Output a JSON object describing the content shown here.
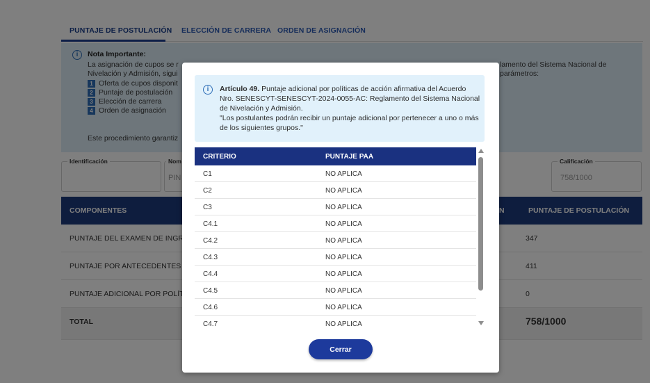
{
  "tabs": [
    "PUNTAJE DE POSTULACIÓN",
    "ELECCIÓN DE CARRERA",
    "ORDEN DE ASIGNACIÓN"
  ],
  "note": {
    "title": "Nota Importante:",
    "line1": "La asignación de cupos se r",
    "line1_right": "lamento del Sistema Nacional de",
    "line2": "Nivelación y Admisión, sigui",
    "line2_right": "parámetros:",
    "items": [
      {
        "num": "1",
        "label": "Oferta de cupos disponit"
      },
      {
        "num": "2",
        "label": "Puntaje de postulación"
      },
      {
        "num": "3",
        "label": "Elección de carrera"
      },
      {
        "num": "4",
        "label": "Orden de asignación"
      }
    ],
    "footer": "Este procedimiento garantiz"
  },
  "fields": {
    "identificacion_label": "Identificación",
    "nombre_label": "Nom",
    "nombre_value": "PIN",
    "calificacion_label": "Calificación",
    "calificacion_value": "758/1000"
  },
  "main_table": {
    "header_left": "COMPONENTES",
    "header_mid": "N",
    "header_right": "PUNTAJE DE POSTULACIÓN",
    "rows": [
      {
        "label": "PUNTAJE DEL EXAMEN DE INGRE",
        "value": "347"
      },
      {
        "label": "PUNTAJE POR ANTECEDENTES A",
        "value": "411"
      },
      {
        "label": "PUNTAJE ADICIONAL POR POLÍTI",
        "value": "0"
      }
    ],
    "total_label": "TOTAL",
    "total_value": "758/1000"
  },
  "modal": {
    "article_bold": "Artículo 49.",
    "article_text": " Puntaje adicional por políticas de acción afirmativa del Acuerdo Nro. SENESCYT-SENESCYT-2024-0055-AC: Reglamento del Sistema Nacional de Nivelación y Admisión.",
    "quote": "\"Los postulantes podrán recibir un puntaje adicional por pertenecer a uno o más de los siguientes grupos.\"",
    "table_headers": [
      "CRITERIO",
      "PUNTAJE PAA"
    ],
    "rows": [
      {
        "criterio": "C1",
        "puntaje": "NO APLICA"
      },
      {
        "criterio": "C2",
        "puntaje": "NO APLICA"
      },
      {
        "criterio": "C3",
        "puntaje": "NO APLICA"
      },
      {
        "criterio": "C4.1",
        "puntaje": "NO APLICA"
      },
      {
        "criterio": "C4.2",
        "puntaje": "NO APLICA"
      },
      {
        "criterio": "C4.3",
        "puntaje": "NO APLICA"
      },
      {
        "criterio": "C4.4",
        "puntaje": "NO APLICA"
      },
      {
        "criterio": "C4.5",
        "puntaje": "NO APLICA"
      },
      {
        "criterio": "C4.6",
        "puntaje": "NO APLICA"
      },
      {
        "criterio": "C4.7",
        "puntaje": "NO APLICA"
      }
    ],
    "close_label": "Cerrar"
  }
}
